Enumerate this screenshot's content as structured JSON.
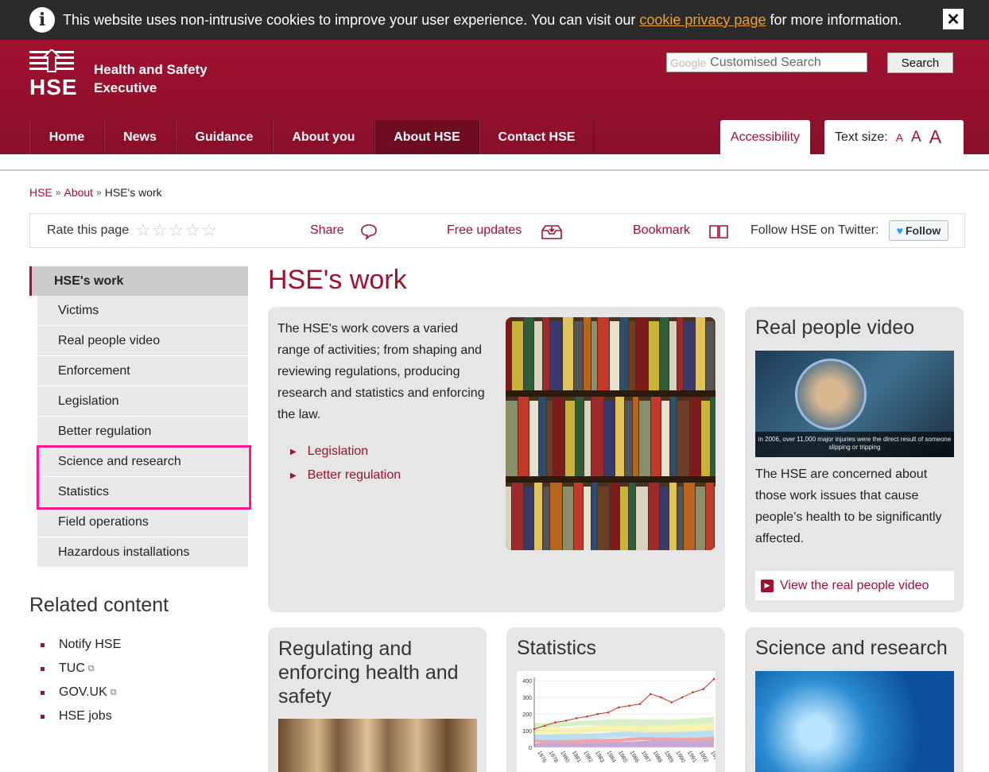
{
  "cookie": {
    "message_before": "This website uses non-intrusive cookies to improve your user experience. You can visit our ",
    "link": "cookie privacy page",
    "message_after": " for more information.",
    "close": "✕"
  },
  "header": {
    "logo_text": "HSE",
    "org_name": "Health and Safety Executive",
    "search_brand": "Google",
    "search_placeholder": "Customised Search",
    "search_button": "Search",
    "nav": [
      "Home",
      "News",
      "Guidance",
      "About you",
      "About HSE",
      "Contact HSE"
    ],
    "active_nav": "About HSE",
    "accessibility": "Accessibility",
    "text_size_label": "Text size:",
    "text_size_options": [
      "A",
      "A",
      "A"
    ]
  },
  "breadcrumb": [
    "HSE",
    "About",
    "HSE's work"
  ],
  "toolbar": {
    "rate": "Rate this page",
    "stars": "☆☆☆☆☆",
    "share": "Share",
    "updates": "Free updates",
    "bookmark": "Bookmark",
    "follow_label": "Follow HSE on Twitter:",
    "follow_button": "Follow"
  },
  "sidebar": {
    "heading": "HSE's work",
    "items": [
      "Victims",
      "Real people video",
      "Enforcement",
      "Legislation",
      "Better regulation",
      "Science and research",
      "Statistics",
      "Field operations",
      "Hazardous installations"
    ]
  },
  "related": {
    "heading": "Related content",
    "items": [
      "Notify HSE",
      "TUC",
      "GOV.UK",
      "HSE jobs"
    ]
  },
  "main": {
    "title": "HSE's work",
    "intro": "The HSE's work covers a varied range of activities; from shaping and reviewing regulations, producing research and statistics and enforcing the law.",
    "links": [
      "Legislation",
      "Better regulation"
    ]
  },
  "video": {
    "title": "Real people video",
    "caption": "in 2006, over 11,000 major injuries were the direct result of someone slipping or tripping",
    "text": "The HSE are concerned about those work issues that cause people’s health to be significantly affected.",
    "link": "View the real people video"
  },
  "cards": {
    "regulating": "Regulating and enforcing health and safety",
    "statistics": "Statistics",
    "science": "Science and research"
  },
  "chart_data": {
    "type": "area",
    "title": "",
    "y_ticks": [
      "400",
      "300",
      "200",
      "100",
      "0"
    ],
    "x_labels": [
      "1976",
      "1978",
      "1980",
      "1981",
      "1982",
      "1983",
      "1984",
      "1985",
      "1986",
      "1987",
      "1988",
      "1989",
      "1990",
      "1991",
      "1992",
      "1993"
    ],
    "ylim": [
      0,
      420
    ],
    "line": [
      110,
      130,
      150,
      160,
      175,
      185,
      200,
      210,
      240,
      250,
      260,
      320,
      300,
      270,
      300,
      330,
      350,
      410
    ]
  },
  "colors": {
    "brand": "#a0112f",
    "highlight": "#ff1493"
  }
}
